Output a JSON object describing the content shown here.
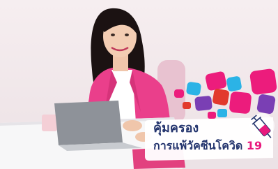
{
  "headline": {
    "line1": "คุ้มครอง",
    "line2_text": "การแพ้วัคซีนโควิด ",
    "line2_number": "19"
  },
  "icons": {
    "vaccine": "syringe-icon"
  },
  "colors": {
    "headline": "#24356e",
    "accent_pink": "#e8197d",
    "blazer_pink": "#ea3f8b",
    "background": "#f3eaed"
  }
}
